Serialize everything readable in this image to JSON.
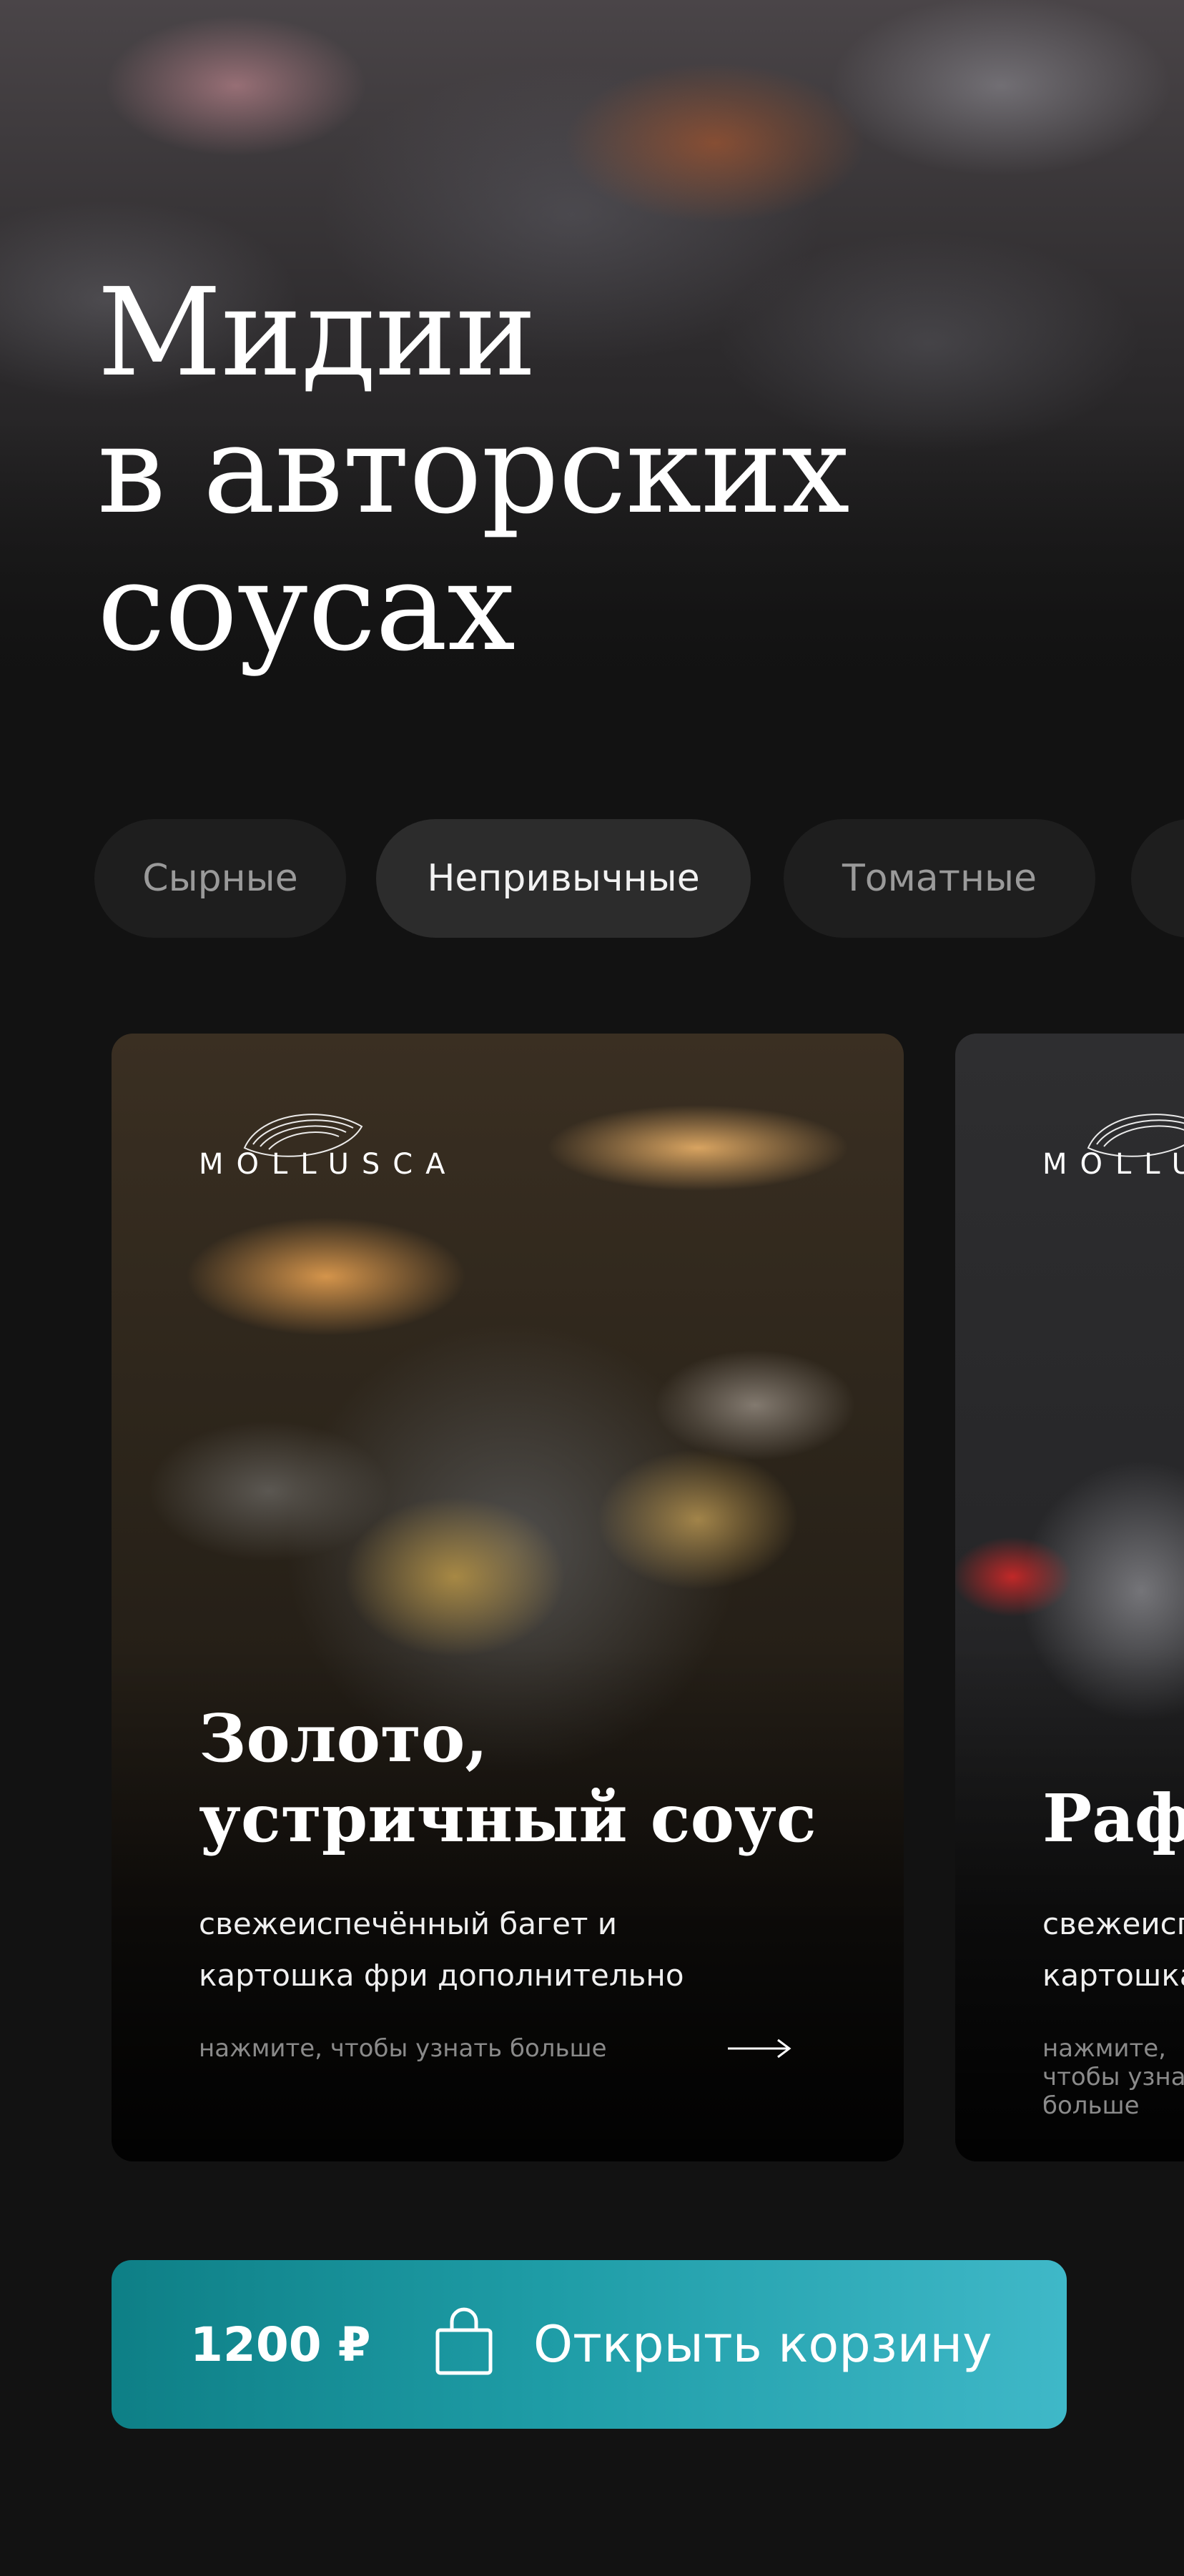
{
  "hero": {
    "title_lines": [
      "Мидии",
      "в авторских",
      "соусах"
    ]
  },
  "filters": [
    {
      "label": "Сырные",
      "active": false
    },
    {
      "label": "Непривычные",
      "active": true
    },
    {
      "label": "Томатные",
      "active": false
    }
  ],
  "cards": [
    {
      "brand": "MOLLUSCA",
      "title_lines": [
        "Золото,",
        "устричный соус"
      ],
      "desc_lines": [
        "свежеиспечённый багет и",
        "картошка фри дополнительно"
      ],
      "hint": "нажмите, чтобы узнать больше"
    },
    {
      "brand": "MOLLUSCA",
      "title_lines": [
        "Рафаэлло"
      ],
      "desc_lines": [
        "свежеиспечённый багет и",
        "картошка фри дополнительно"
      ],
      "hint": "нажмите, чтобы узнать больше"
    }
  ],
  "cart": {
    "price": "1200 ₽",
    "label": "Открыть корзину",
    "icon": "shopping-bag-icon"
  },
  "colors": {
    "background": "#121212",
    "pill_bg": "#1e1e1e",
    "pill_active_bg": "#2c2c2c",
    "cart_gradient_start": "#0e7f86",
    "cart_gradient_end": "#3fb8c8"
  }
}
